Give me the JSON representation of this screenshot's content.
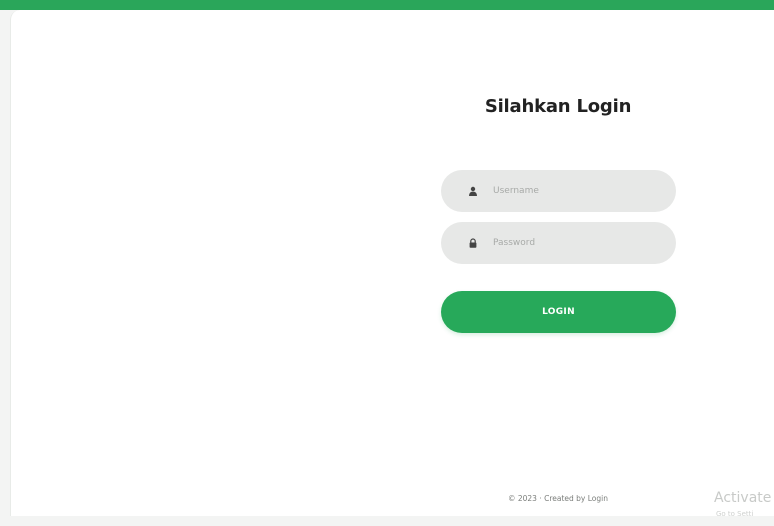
{
  "login": {
    "title": "Silahkan Login",
    "username_placeholder": "Username",
    "username_icon": "user-icon",
    "password_placeholder": "Password",
    "password_icon": "lock-icon",
    "button_label": "LOGIN"
  },
  "footer": {
    "text": "© 2023 · Created by Login"
  },
  "watermark": {
    "title": "Activate",
    "subtitle": "Go to Setti"
  },
  "colors": {
    "accent": "#27a95a",
    "input_bg": "#e7e8e7",
    "title": "#222222"
  }
}
